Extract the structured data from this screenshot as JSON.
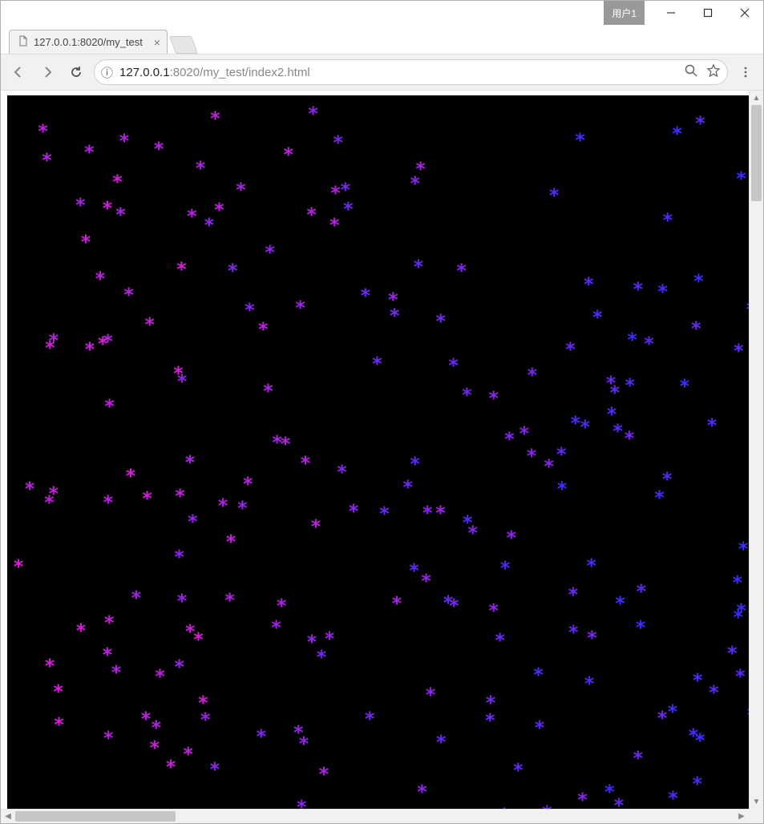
{
  "window": {
    "user_tag": "用户1"
  },
  "tab": {
    "title": "127.0.0.1:8020/my_test"
  },
  "omnibox": {
    "info_glyph": "ⓘ",
    "host": "127.0.0.1",
    "port": ":8020",
    "path": "/my_test/index2.html"
  },
  "stars": {
    "glyph": "*",
    "count": 200,
    "seed": 42,
    "color_left": "#d81bd8",
    "color_right": "#3a2cff",
    "font_size_px": 24
  }
}
